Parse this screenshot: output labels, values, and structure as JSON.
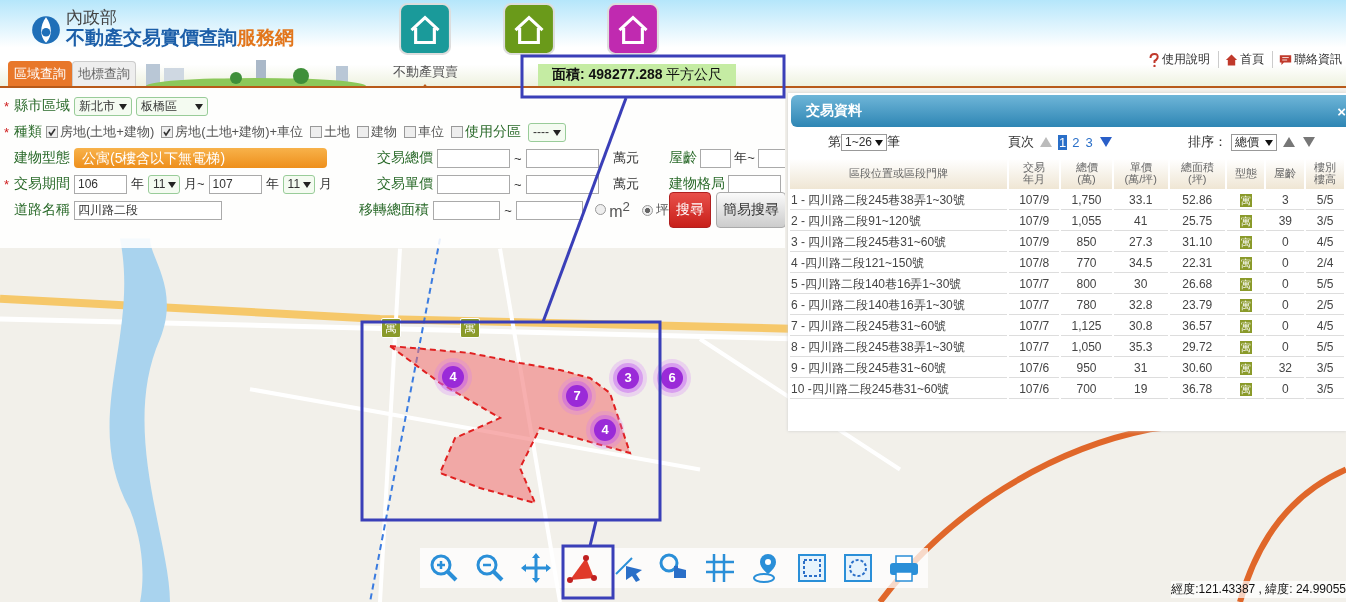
{
  "header": {
    "agency": "內政部",
    "title": "不動產交易實價查詢",
    "title_suffix": "服務網",
    "nav": [
      {
        "label": "不動產買賣",
        "selected": true,
        "kind": "sale"
      },
      {
        "selected": false,
        "kind": "rent"
      },
      {
        "selected": false,
        "kind": "presale"
      }
    ],
    "links": [
      {
        "label": "使用說明",
        "kind": "help"
      },
      {
        "label": "首頁",
        "kind": "home"
      },
      {
        "label": "聯絡資訊",
        "kind": "contact"
      }
    ],
    "tabs": [
      {
        "label": "區域查詢",
        "selected": true
      },
      {
        "label": "地標查詢",
        "selected": false
      }
    ]
  },
  "area_label": "**面積: 498277.288** 平方公尺",
  "form": {
    "region": {
      "required_mark": "*",
      "label": "縣市區域",
      "city": "新北市",
      "district": "板橋區"
    },
    "types": {
      "required_mark": "*",
      "label": "種類",
      "options": [
        {
          "label": "房地(土地+建物)",
          "checked": true
        },
        {
          "label": "房地(土地+建物)+車位",
          "checked": true
        },
        {
          "label": "土地",
          "checked": false
        },
        {
          "label": "建物",
          "checked": false
        },
        {
          "label": "車位",
          "checked": false
        }
      ],
      "zoning": {
        "label": "使用分區",
        "checked": false,
        "value": "----"
      }
    },
    "building_type": {
      "label": "建物型態",
      "value": "公寓(5樓含以下無電梯)"
    },
    "period": {
      "required_mark": "*",
      "label": "交易期間",
      "from_year": "106",
      "year_unit": "年",
      "from_month": "11",
      "month_to": "月~",
      "to_year": "107",
      "to_year_unit": "年",
      "to_month": "11",
      "month_unit": "月"
    },
    "road": {
      "label": "道路名稱",
      "value": "四川路二段"
    },
    "ranges": [
      {
        "label": "交易總價",
        "sep": "~",
        "unit": "萬元"
      },
      {
        "label": "交易單價",
        "sep": "~",
        "unit": "萬元"
      },
      {
        "label": "移轉總面積",
        "sep": "~"
      }
    ],
    "area_units": [
      {
        "label": "m$^{2}$",
        "selected": false
      },
      {
        "label": "坪",
        "selected": true
      }
    ],
    "age": {
      "label": "屋齡",
      "unit": "年~"
    },
    "layout": {
      "label": "建物格局"
    },
    "buttons": [
      {
        "label": "搜尋",
        "kind": "primary"
      },
      {
        "label": "簡易搜尋",
        "kind": "secondary"
      }
    ]
  },
  "map": {
    "clusters": [
      {
        "count": "4"
      },
      {
        "count": "7"
      },
      {
        "count": "3"
      },
      {
        "count": "6"
      },
      {
        "count": "4"
      }
    ],
    "markers": [
      {
        "label": "寓"
      },
      {
        "label": "寓"
      }
    ],
    "coordinates": "經度:121.43387 , 緯度: 24.99055"
  },
  "panel": {
    "title": "交易資料",
    "close": "×",
    "range_prefix": "第",
    "range": "1~26",
    "range_suffix": "筆",
    "page_label": "頁次",
    "pages": [
      {
        "label": "1",
        "selected": true
      },
      {
        "label": "2",
        "selected": false
      },
      {
        "label": "3",
        "selected": false
      }
    ],
    "sort_label": "排序：",
    "sort": "總價",
    "columns": [
      [
        "區段位置或區段門牌"
      ],
      [
        "交易",
        "年月"
      ],
      [
        "總價",
        "(萬)"
      ],
      [
        "單價",
        "(萬/坪)"
      ],
      [
        "總面積",
        "(坪)"
      ],
      [
        "型態"
      ],
      [
        "屋齡"
      ],
      [
        "樓別",
        "樓高"
      ]
    ],
    "rows": [
      {
        "address": "1 - 四川路二段245巷38弄1~30號",
        "date": "107/9",
        "total": "1,750",
        "unit": "33.1",
        "area": "52.86",
        "type": "寓",
        "age": "3",
        "floor": "5/5"
      },
      {
        "address": "2 - 四川路二段91~120號",
        "date": "107/9",
        "total": "1,055",
        "unit": "41",
        "area": "25.75",
        "type": "寓",
        "age": "39",
        "floor": "3/5"
      },
      {
        "address": "3 - 四川路二段245巷31~60號",
        "date": "107/9",
        "total": "850",
        "unit": "27.3",
        "area": "31.10",
        "type": "寓",
        "age": "0",
        "floor": "4/5"
      },
      {
        "address": "4 -四川路二段121~150號",
        "date": "107/8",
        "total": "770",
        "unit": "34.5",
        "area": "22.31",
        "type": "寓",
        "age": "0",
        "floor": "2/4"
      },
      {
        "address": "5 -四川路二段140巷16弄1~30號",
        "date": "107/7",
        "total": "800",
        "unit": "30",
        "area": "26.68",
        "type": "寓",
        "age": "0",
        "floor": "5/5"
      },
      {
        "address": "6 - 四川路二段140巷16弄1~30號",
        "date": "107/7",
        "total": "780",
        "unit": "32.8",
        "area": "23.79",
        "type": "寓",
        "age": "0",
        "floor": "2/5"
      },
      {
        "address": "7 - 四川路二段245巷31~60號",
        "date": "107/7",
        "total": "1,125",
        "unit": "30.8",
        "area": "36.57",
        "type": "寓",
        "age": "0",
        "floor": "4/5"
      },
      {
        "address": "8 - 四川路二段245巷38弄1~30號",
        "date": "107/7",
        "total": "1,050",
        "unit": "35.3",
        "area": "29.72",
        "type": "寓",
        "age": "0",
        "floor": "5/5"
      },
      {
        "address": "9 - 四川路二段245巷31~60號",
        "date": "107/6",
        "total": "950",
        "unit": "31",
        "area": "30.60",
        "type": "寓",
        "age": "32",
        "floor": "3/5"
      },
      {
        "address": "10 -四川路二段245巷31~60號",
        "date": "107/6",
        "total": "700",
        "unit": "19",
        "area": "36.78",
        "type": "寓",
        "age": "0",
        "floor": "3/5"
      }
    ]
  }
}
